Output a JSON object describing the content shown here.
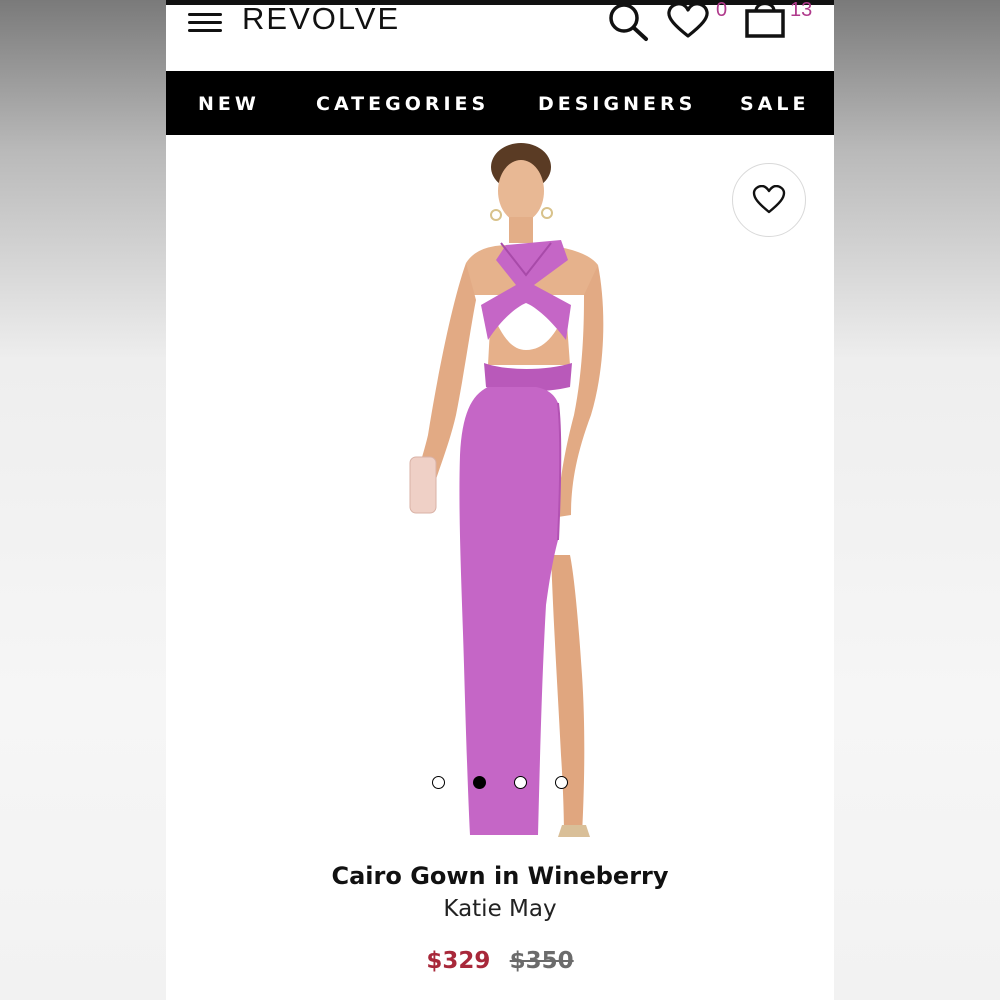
{
  "header": {
    "logo": "REVOLVE",
    "wishlist_count": "0",
    "bag_count": "13",
    "icons": [
      "menu-icon",
      "search-icon",
      "heart-icon",
      "shopping-bag-icon"
    ]
  },
  "nav": {
    "items": [
      "NEW",
      "CATEGORIES",
      "DESIGNERS",
      "SALE"
    ]
  },
  "product": {
    "image_alt_icon": "model-wearing-gown",
    "dress_color": "#c566c6",
    "carousel": {
      "count": 4,
      "active_index": 1
    },
    "title": "Cairo Gown in Wineberry",
    "brand": "Katie May",
    "sale_price": "$329",
    "original_price": "$350",
    "favorite_icon": "heart-outline-icon"
  },
  "colors": {
    "sale_price": "#a8283a",
    "count_accent": "#b03a8c",
    "nav_bg": "#000000"
  }
}
